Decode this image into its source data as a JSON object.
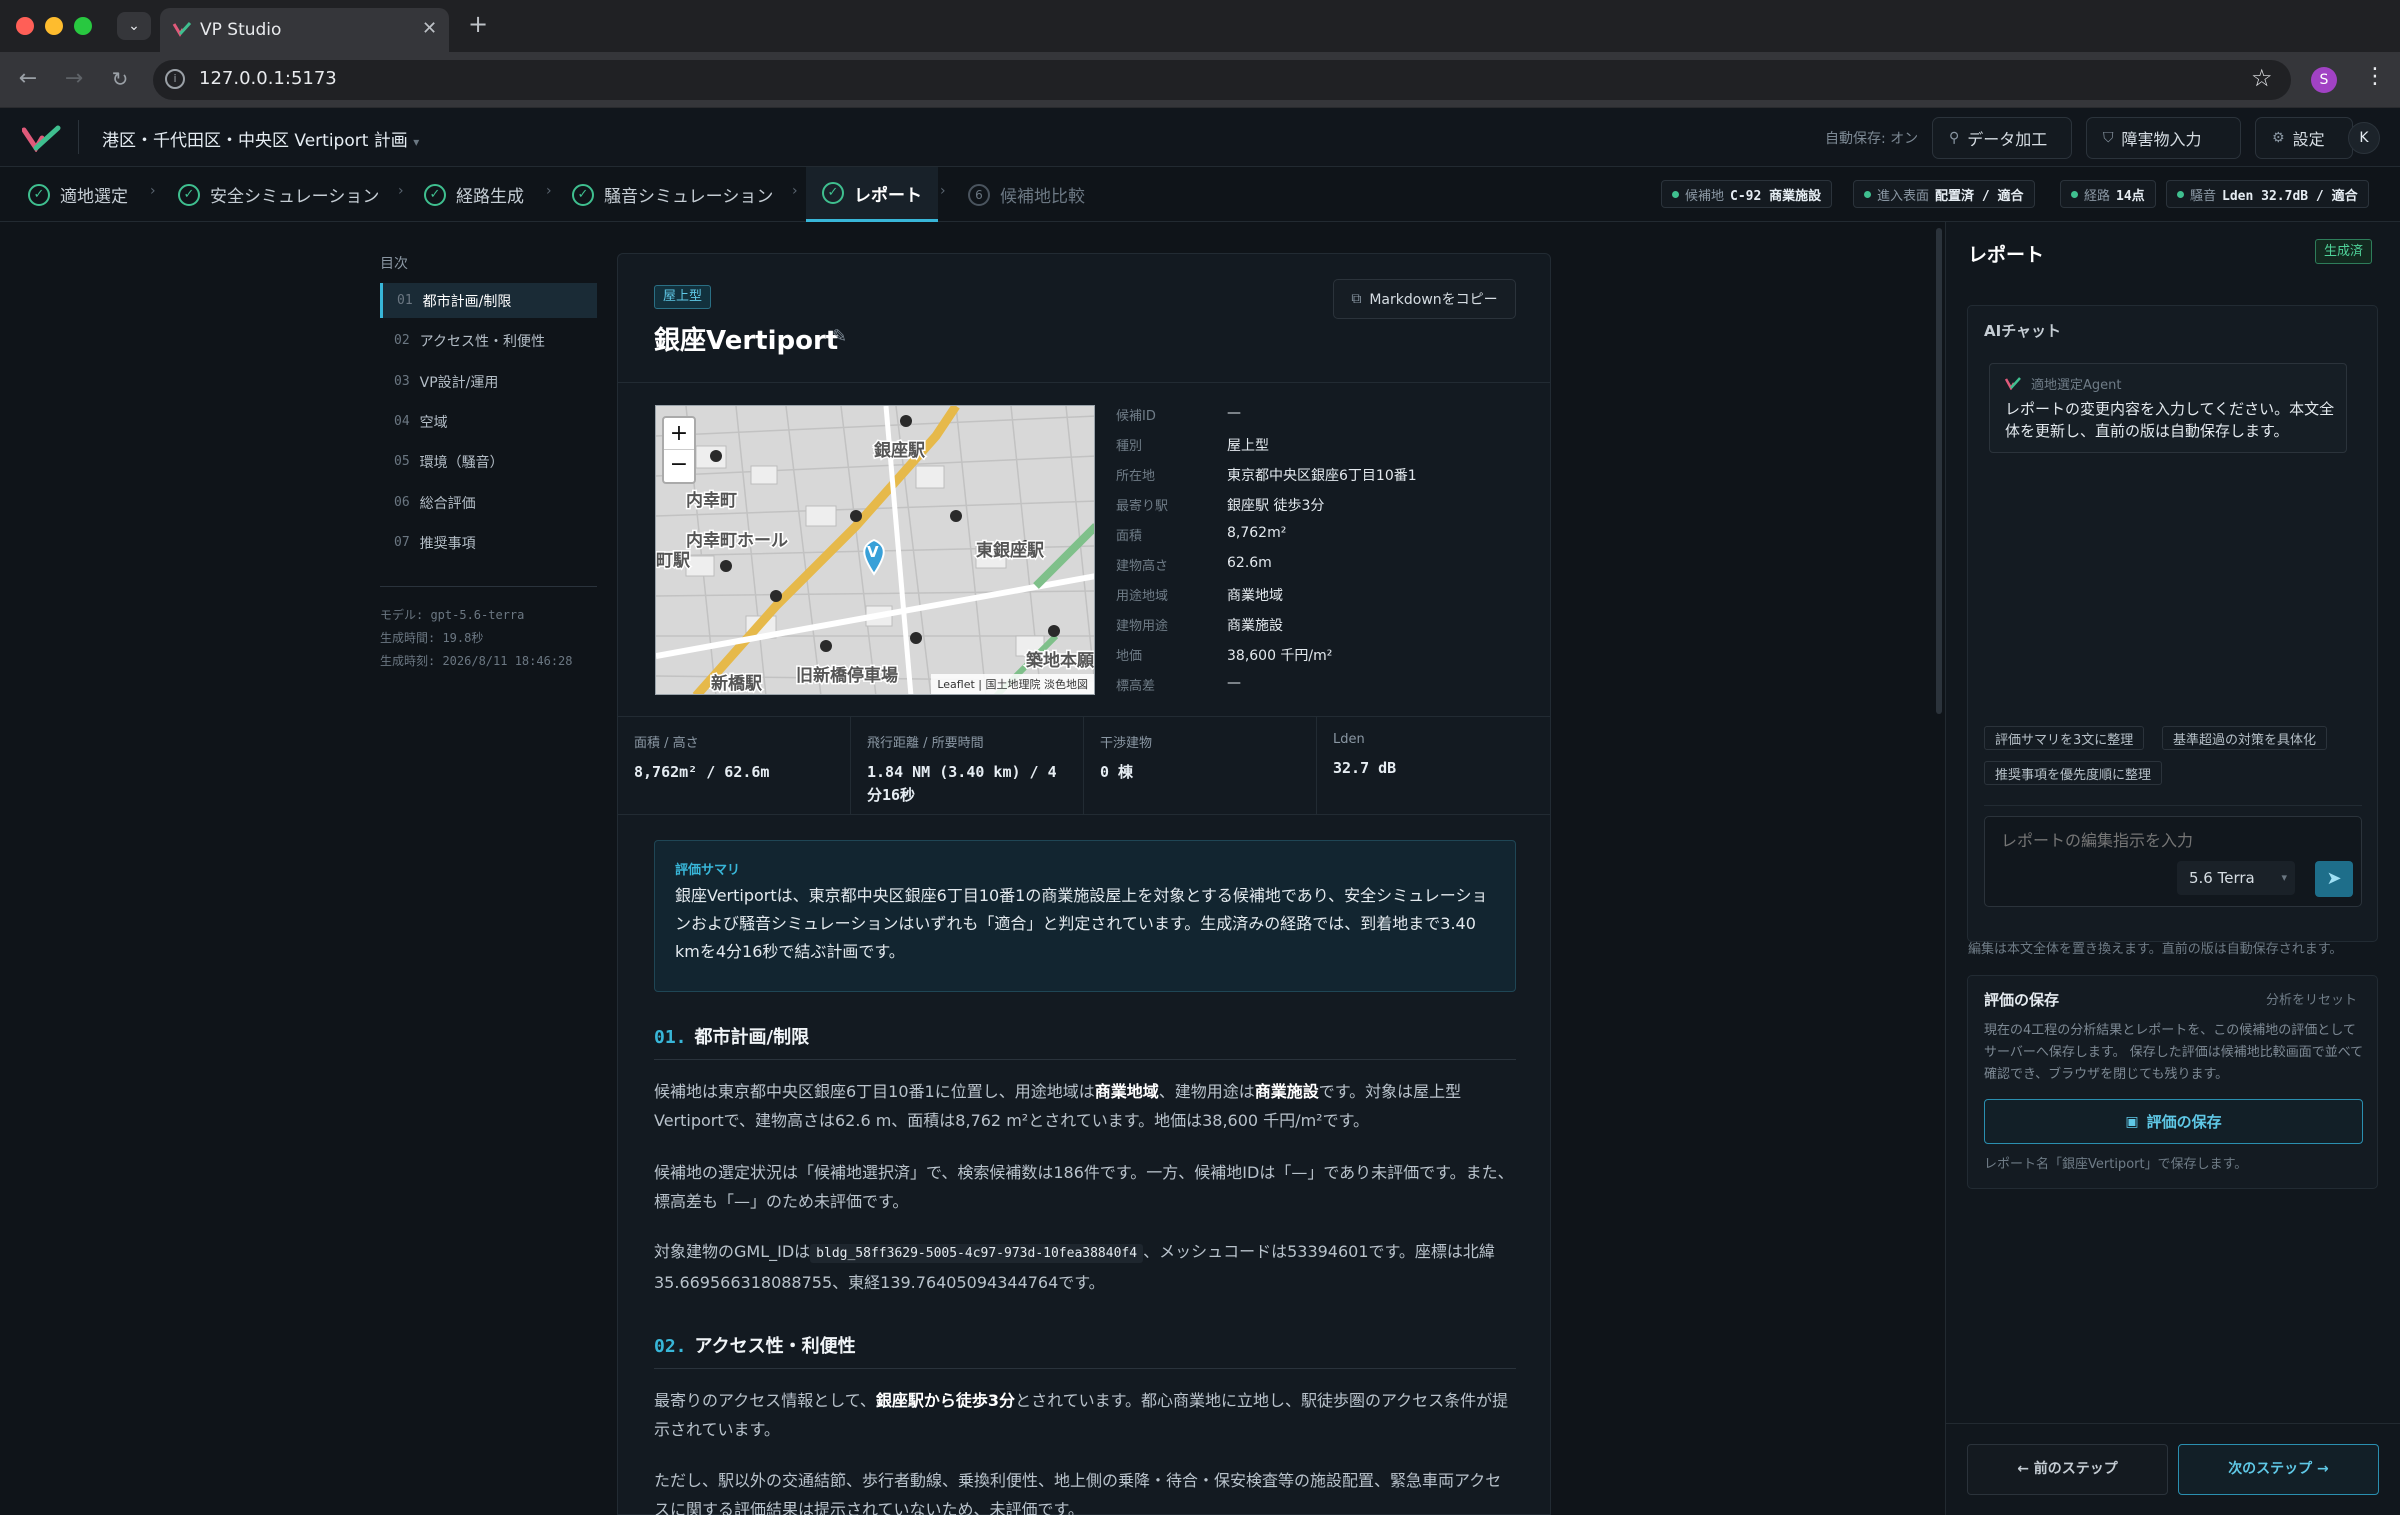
{
  "browser": {
    "tab_title": "VP Studio",
    "url": "127.0.0.1:5173",
    "profile_initial": "S"
  },
  "app": {
    "project_title": "港区・千代田区・中央区 Vertiport 計画",
    "autosave": "自動保存: オン",
    "data_btn": "データ加工",
    "obstacle_btn": "障害物入力",
    "settings_btn": "設定",
    "user_initial": "K"
  },
  "steps": [
    {
      "label": "適地選定",
      "done": true
    },
    {
      "label": "安全シミュレーション",
      "done": true
    },
    {
      "label": "経路生成",
      "done": true
    },
    {
      "label": "騒音シミュレーション",
      "done": true
    },
    {
      "label": "レポート",
      "done": true,
      "active": true
    },
    {
      "label": "候補地比較",
      "num": "6"
    }
  ],
  "status_chips": [
    {
      "key": "候補地",
      "value": "C-92 商業施設"
    },
    {
      "key": "進入表面",
      "value": "配置済 / 適合"
    },
    {
      "key": "経路",
      "value": "14点"
    },
    {
      "key": "騒音",
      "value": "Lden 32.7dB / 適合"
    }
  ],
  "toc": {
    "title": "目次",
    "items": [
      {
        "num": "01",
        "label": "都市計画/制限"
      },
      {
        "num": "02",
        "label": "アクセス性・利便性"
      },
      {
        "num": "03",
        "label": "VP設計/運用"
      },
      {
        "num": "04",
        "label": "空域"
      },
      {
        "num": "05",
        "label": "環境（騒音）"
      },
      {
        "num": "06",
        "label": "総合評価"
      },
      {
        "num": "07",
        "label": "推奨事項"
      }
    ],
    "model": "モデル: gpt-5.6-terra",
    "gen_time": "生成時間: 19.8秒",
    "gen_at": "生成時刻: 2026/8/11 18:46:28"
  },
  "report": {
    "badge": "屋上型",
    "title": "銀座Vertiport",
    "copy_btn": "Markdownをコピー",
    "map_attribution": "Leaflet | 国土地理院 淡色地図",
    "map_labels": [
      "銀座駅",
      "内幸町",
      "内幸町ホール",
      "町駅",
      "東銀座駅",
      "新橋駅",
      "旧新橋停車場",
      "築地本願"
    ],
    "details": [
      {
        "k": "候補ID",
        "v": "—"
      },
      {
        "k": "種別",
        "v": "屋上型"
      },
      {
        "k": "所在地",
        "v": "東京都中央区銀座6丁目10番1"
      },
      {
        "k": "最寄り駅",
        "v": "銀座駅 徒歩3分"
      },
      {
        "k": "面積",
        "v": "8,762m²"
      },
      {
        "k": "建物高さ",
        "v": "62.6m"
      },
      {
        "k": "用途地域",
        "v": "商業地域"
      },
      {
        "k": "建物用途",
        "v": "商業施設"
      },
      {
        "k": "地価",
        "v": "38,600 千円/m²"
      },
      {
        "k": "標高差",
        "v": "—"
      }
    ],
    "metrics": [
      {
        "k": "面積 / 高さ",
        "v": "8,762m² / 62.6m"
      },
      {
        "k": "飛行距離 / 所要時間",
        "v": "1.84 NM (3.40 km) / 4分16秒"
      },
      {
        "k": "干渉建物",
        "v": "0 棟"
      },
      {
        "k": "Lden",
        "v": "32.7 dB"
      }
    ],
    "summary_title": "評価サマリ",
    "summary": "銀座Vertiportは、東京都中央区銀座6丁目10番1の商業施設屋上を対象とする候補地であり、安全シミュレーションおよび騒音シミュレーションはいずれも「適合」と判定されています。生成済みの経路では、到着地まで3.40 kmを4分16秒で結ぶ計画です。",
    "s1_num": "01.",
    "s1_title": "都市計画/制限",
    "s1_p1a": "候補地は東京都中央区銀座6丁目10番1に位置し、用途地域は",
    "s1_p1b": "商業地域",
    "s1_p1c": "、建物用途は",
    "s1_p1d": "商業施設",
    "s1_p1e": "です。対象は屋上型Vertiportで、建物高さは62.6 m、面積は8,762 m²とされています。地価は38,600 千円/m²です。",
    "s1_p2": "候補地の選定状況は「候補地選択済」で、検索候補数は186件です。一方、候補地IDは「—」であり未評価です。また、標高差も「—」のため未評価です。",
    "s1_p3a": "対象建物のGML_IDは",
    "s1_p3code": "bldg_58ff3629-5005-4c97-973d-10fea38840f4",
    "s1_p3b": "、メッシュコードは53394601です。座標は北緯35.669566318088755、東経139.76405094344764です。",
    "s2_num": "02.",
    "s2_title": "アクセス性・利便性",
    "s2_p1a": "最寄りのアクセス情報として、",
    "s2_p1b": "銀座駅から徒歩3分",
    "s2_p1c": "とされています。都心商業地に立地し、駅徒歩圏のアクセス条件が提示されています。",
    "s2_p2": "ただし、駅以外の交通結節、歩行者動線、乗換利便性、地上側の乗降・待合・保安検査等の施設配置、緊急車両アクセスに関する評価結果は提示されていないため、未評価です。"
  },
  "panel": {
    "title": "レポート",
    "status": "生成済",
    "chat_title": "AIチャット",
    "agent_name": "適地選定Agent",
    "agent_msg": "レポートの変更内容を入力してください。本文全体を更新し、直前の版は自動保存します。",
    "suggestions": [
      "評価サマリを3文に整理",
      "基準超過の対策を具体化",
      "推奨事項を優先度順に整理"
    ],
    "input_placeholder": "レポートの編集指示を入力",
    "model_select": "5.6 Terra",
    "edit_note": "編集は本文全体を置き換えます。直前の版は自動保存されます。",
    "save_title": "評価の保存",
    "reset_link": "分析をリセット",
    "save_desc": "現在の4工程の分析結果とレポートを、この候補地の評価としてサーバーへ保存します。 保存した評価は候補地比較画面で並べて確認でき、ブラウザを閉じても残ります。",
    "save_btn": "評価の保存",
    "save_note": "レポート名「銀座Vertiport」で保存します。",
    "prev_btn": "← 前のステップ",
    "next_btn": "次のステップ →"
  }
}
